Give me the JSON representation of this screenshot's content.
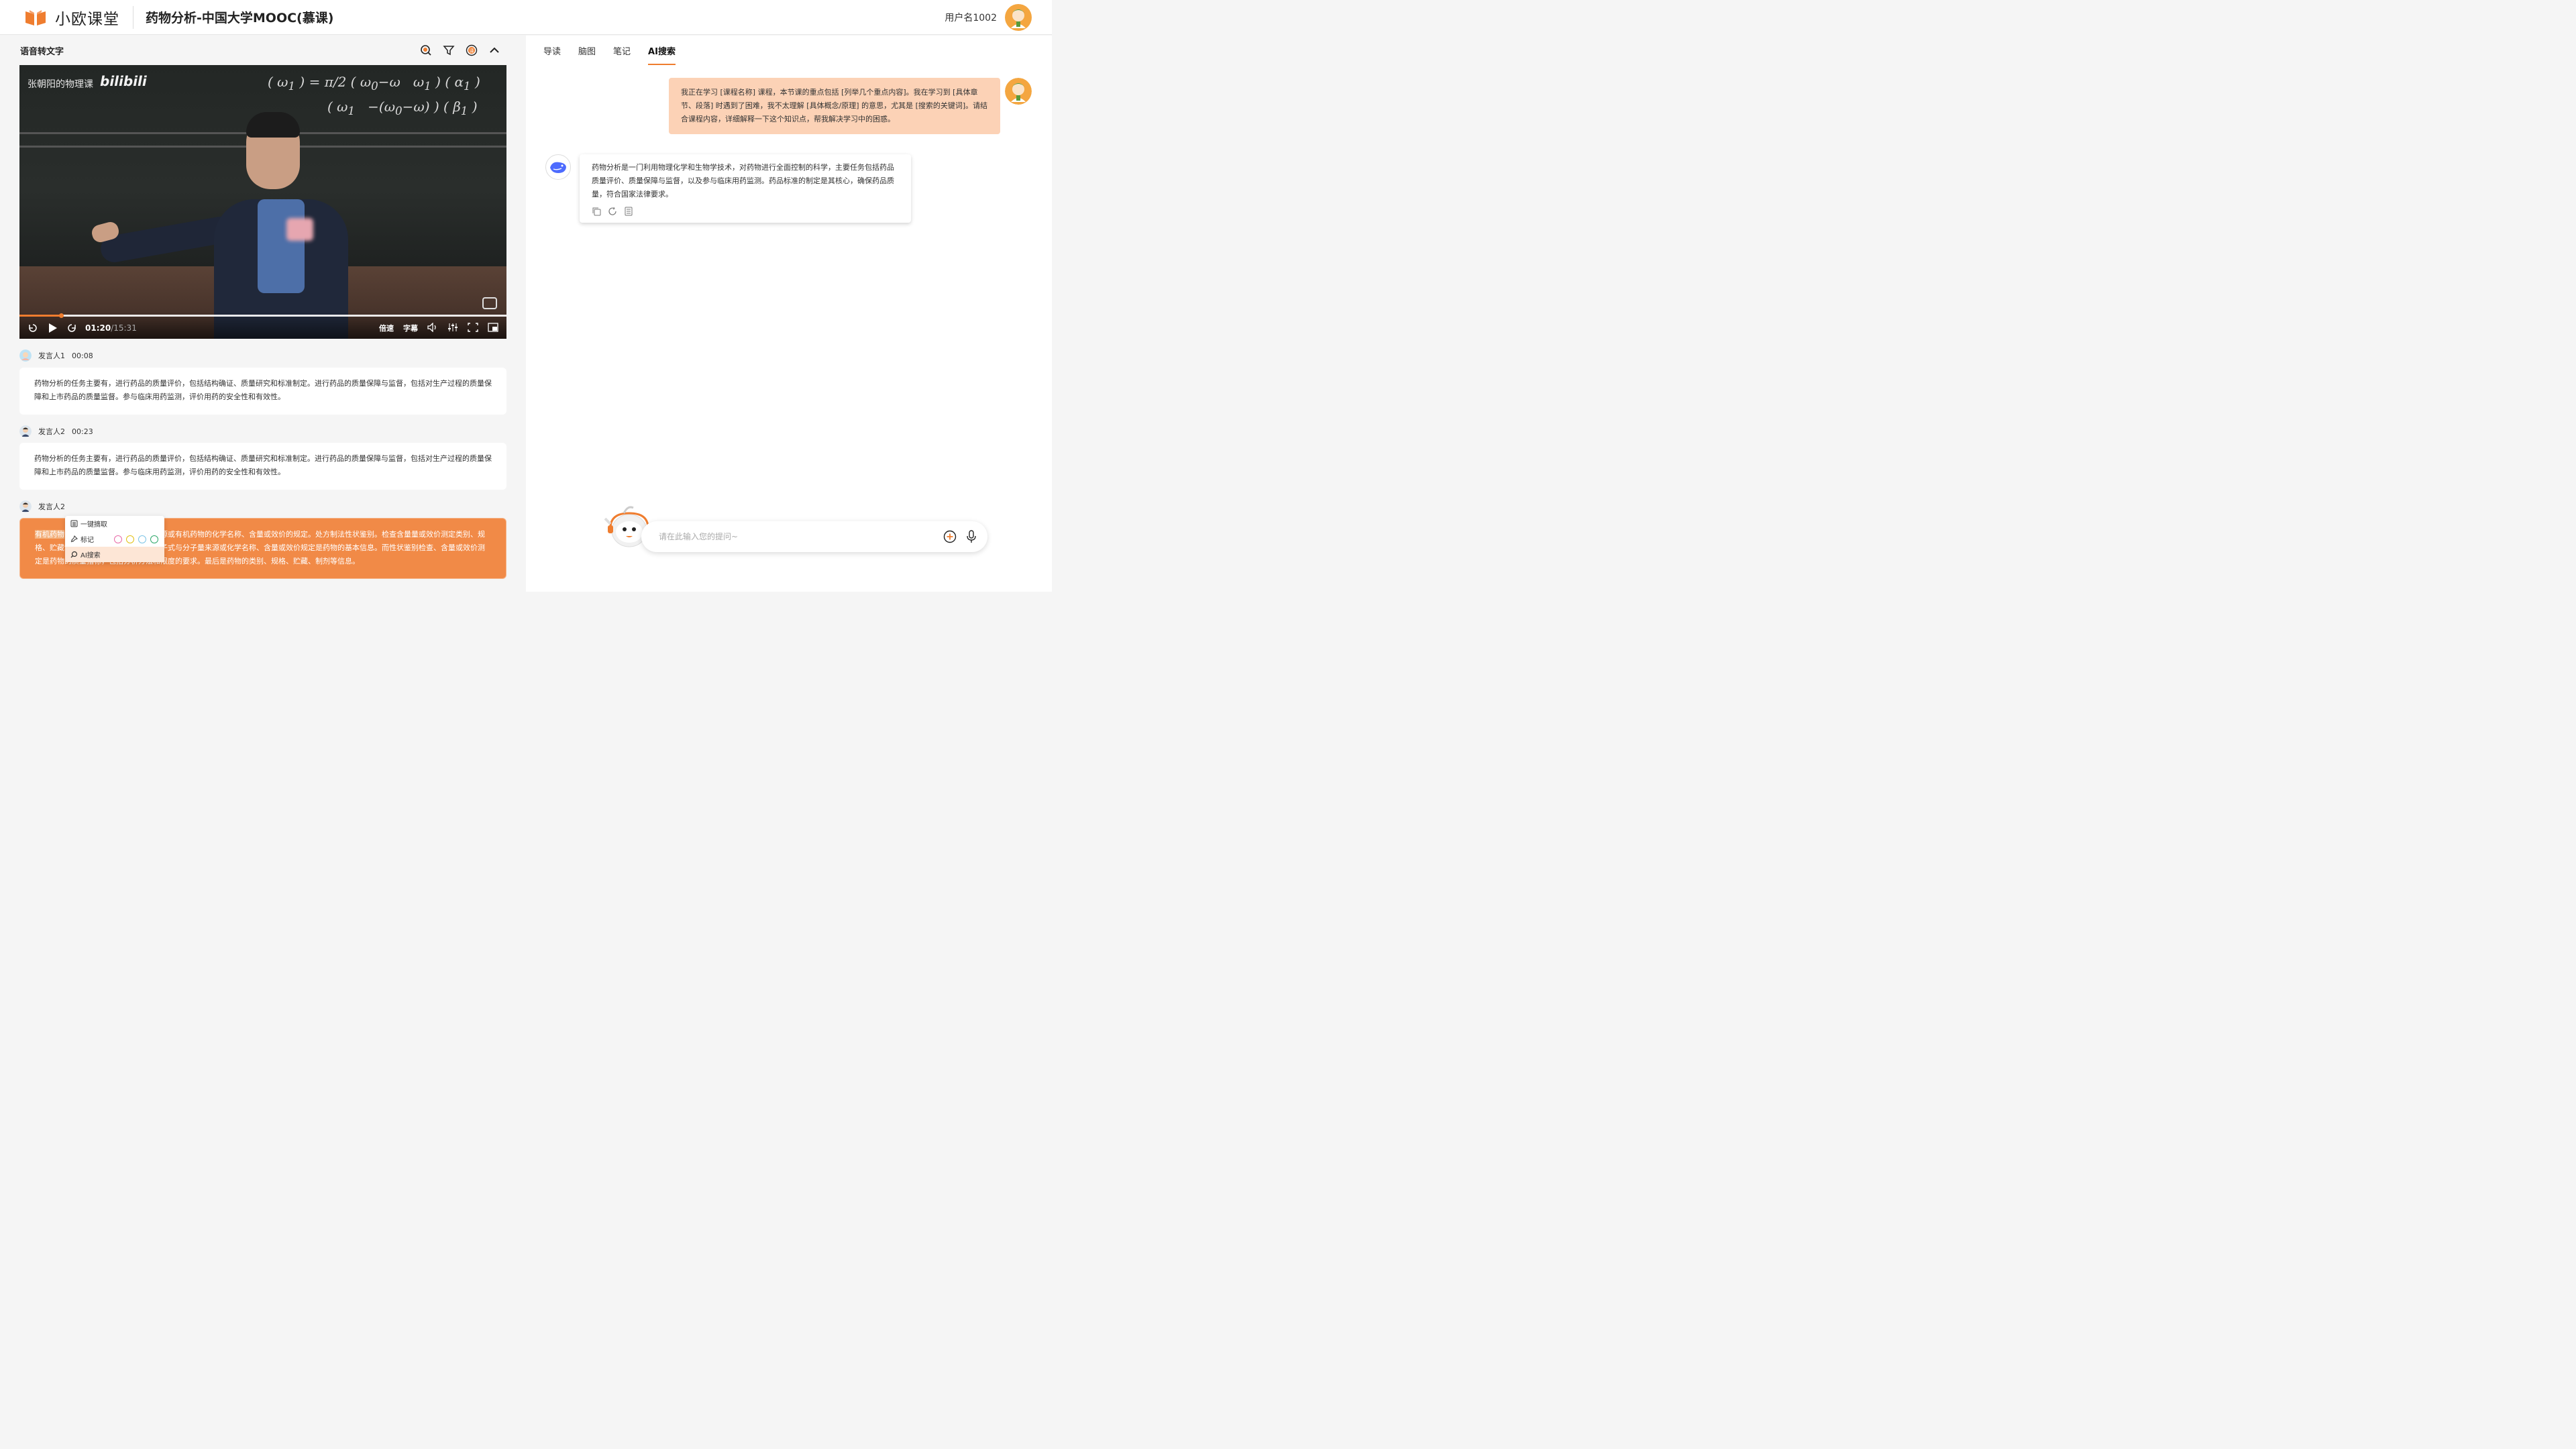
{
  "header": {
    "logo_text": "小欧课堂",
    "course_title": "药物分析-中国大学MOOC(慕课)",
    "username": "用户名1002"
  },
  "left_panel": {
    "title": "语音转文字",
    "video": {
      "watermark_channel": "张朝阳的物理课",
      "watermark_brand": "bilibili",
      "current_time": "01:20",
      "total_time": "/15:31",
      "progress": 0.086,
      "speed_label": "倍速",
      "subtitle_label": "字幕"
    },
    "transcript": [
      {
        "speaker": "发言人1",
        "time": "00:08",
        "text": "药物分析的任务主要有，进行药品的质量评价，包括结构确证、质量研究和标准制定。进行药品的质量保障与监督，包括对生产过程的质量保障和上市药品的质量监督。参与临床用药监测，评价用药的安全性和有效性。"
      },
      {
        "speaker": "发言人2",
        "time": "00:23",
        "text": "药物分析的任务主要有，进行药品的质量评价，包括结构确证、质量研究和标准制定。进行药品的质量保障与监督，包括对生产过程的质量保障和上市药品的质量监督。参与临床用药监测，评价用药的安全性和有效性。"
      },
      {
        "speaker": "发言人2",
        "time": "",
        "highlight": "有机药物",
        "text": "的结构式、分子式与分子量来源或有机药物的化学名称、含量或效价的规定。处方制法性状鉴别。检查含量量或效价测定类别、规格、贮藏制剂。其中品名、结构式、分子式与分子量来源或化学名称、含量或效价规定是药物的基本信息。而性状鉴别检查、含量或效价测定是药物的质量指标，包括分析方法和限度的要求。最后是药物的类别、规格、贮藏、制剂等信息。"
      }
    ],
    "context_menu": {
      "extract": "一键摘取",
      "mark": "标记",
      "ai_search": "AI搜索"
    }
  },
  "right_panel": {
    "tabs": [
      "导读",
      "脑图",
      "笔记",
      "AI搜索"
    ],
    "active_tab": "AI搜索",
    "user_message": "我正在学习 [课程名称] 课程，本节课的重点包括 [列举几个重点内容]。我在学习到 [具体章节、段落] 时遇到了困难，我不太理解 [具体概念/原理] 的意思，尤其是 [搜索的关键词]。请结合课程内容，详细解释一下这个知识点，帮我解决学习中的困惑。",
    "ai_message": "药物分析是一门利用物理化学和生物学技术，对药物进行全面控制的科学，主要任务包括药品质量评价、质量保障与监督，以及参与临床用药监测。药品标准的制定是其核心，确保药品质量，符合国家法律要求。",
    "input_placeholder": "请在此输入您的提问~"
  },
  "colors": {
    "accent": "#ef7d2f",
    "user_bubble": "#fcd2b6",
    "highlight_card": "#f18a47"
  }
}
